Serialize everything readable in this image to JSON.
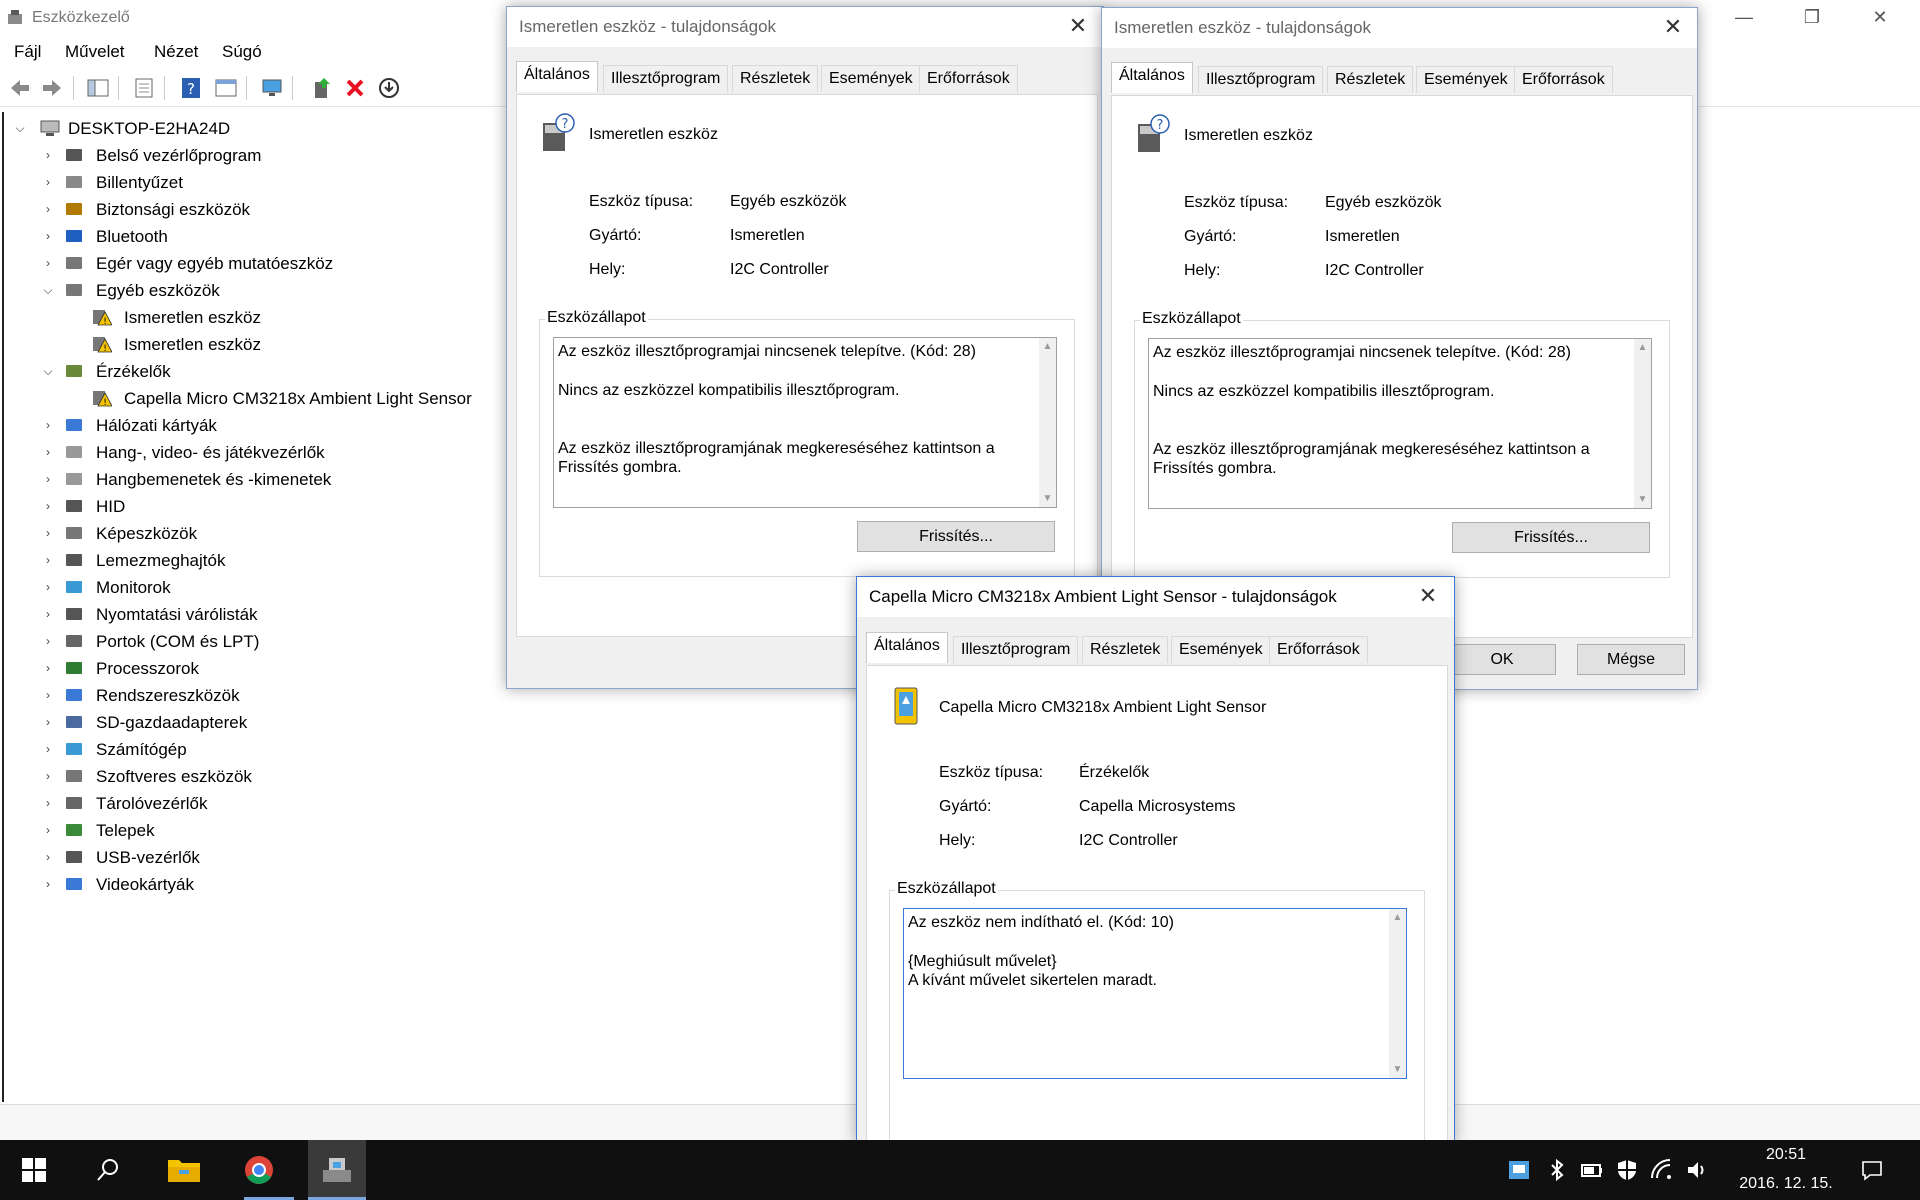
{
  "app": {
    "title": "Eszközkezelő"
  },
  "menu": [
    "Fájl",
    "Művelet",
    "Nézet",
    "Súgó"
  ],
  "tree": {
    "root": "DESKTOP-E2HA24D",
    "items": [
      {
        "label": "Belső vezérlőprogram"
      },
      {
        "label": "Billentyűzet"
      },
      {
        "label": "Biztonsági eszközök"
      },
      {
        "label": "Bluetooth"
      },
      {
        "label": "Egér vagy egyéb mutatóeszköz"
      },
      {
        "label": "Egyéb eszközök"
      },
      {
        "label": "Ismeretlen eszköz"
      },
      {
        "label": "Ismeretlen eszköz"
      },
      {
        "label": "Érzékelők"
      },
      {
        "label": "Capella Micro CM3218x Ambient Light Sensor"
      },
      {
        "label": "Hálózati kártyák"
      },
      {
        "label": "Hang-, video- és játékvezérlők"
      },
      {
        "label": "Hangbemenetek és -kimenetek"
      },
      {
        "label": "HID"
      },
      {
        "label": "Képeszközök"
      },
      {
        "label": "Lemezmeghajtók"
      },
      {
        "label": "Monitorok"
      },
      {
        "label": "Nyomtatási várólisták"
      },
      {
        "label": "Portok (COM és LPT)"
      },
      {
        "label": "Processzorok"
      },
      {
        "label": "Rendszereszközök"
      },
      {
        "label": "SD-gazdaadapterek"
      },
      {
        "label": "Számítógép"
      },
      {
        "label": "Szoftveres eszközök"
      },
      {
        "label": "Tárolóvezérlők"
      },
      {
        "label": "Telepek"
      },
      {
        "label": "USB-vezérlők"
      },
      {
        "label": "Videokártyák"
      }
    ]
  },
  "tabs": [
    "Általános",
    "Illesztőprogram",
    "Részletek",
    "Események",
    "Erőforrások"
  ],
  "labels": {
    "type": "Eszköz típusa:",
    "maker": "Gyártó:",
    "location": "Hely:",
    "status_group": "Eszközállapot"
  },
  "dialog1": {
    "title": "Ismeretlen eszköz - tulajdonságok",
    "device_name": "Ismeretlen eszköz",
    "type": "Egyéb eszközök",
    "maker": "Ismeretlen",
    "location": "I2C Controller",
    "status_line1": "Az eszköz illesztőprogramjai nincsenek telepítve. (Kód: 28)",
    "status_line2": "Nincs az eszközzel kompatibilis illesztőprogram.",
    "status_line3": "Az eszköz illesztőprogramjának megkereséséhez kattintson a Frissítés gombra.",
    "button": "Frissítés..."
  },
  "dialog2": {
    "title": "Ismeretlen eszköz - tulajdonságok",
    "device_name": "Ismeretlen eszköz",
    "type": "Egyéb eszközök",
    "maker": "Ismeretlen",
    "location": "I2C Controller",
    "status_line1": "Az eszköz illesztőprogramjai nincsenek telepítve. (Kód: 28)",
    "status_line2": "Nincs az eszközzel kompatibilis illesztőprogram.",
    "status_line3": "Az eszköz illesztőprogramjának megkereséséhez kattintson a Frissítés gombra.",
    "button": "Frissítés...",
    "ok": "OK",
    "cancel": "Mégse"
  },
  "dialog3": {
    "title": "Capella Micro CM3218x Ambient Light Sensor - tulajdonságok",
    "device_name": "Capella Micro CM3218x Ambient Light Sensor",
    "type": "Érzékelők",
    "maker": "Capella Microsystems",
    "location": "I2C Controller",
    "status_line1": "Az eszköz nem indítható el. (Kód: 10)",
    "status_line2": "{Meghiúsult művelet}",
    "status_line3": "A kívánt művelet sikertelen maradt."
  },
  "clock": {
    "time": "20:51",
    "date": "2016. 12. 15."
  },
  "colors": {
    "taskbar": "#101010",
    "accent": "#3a7ad6",
    "warning": "#f3c300",
    "error": "#e81123"
  }
}
